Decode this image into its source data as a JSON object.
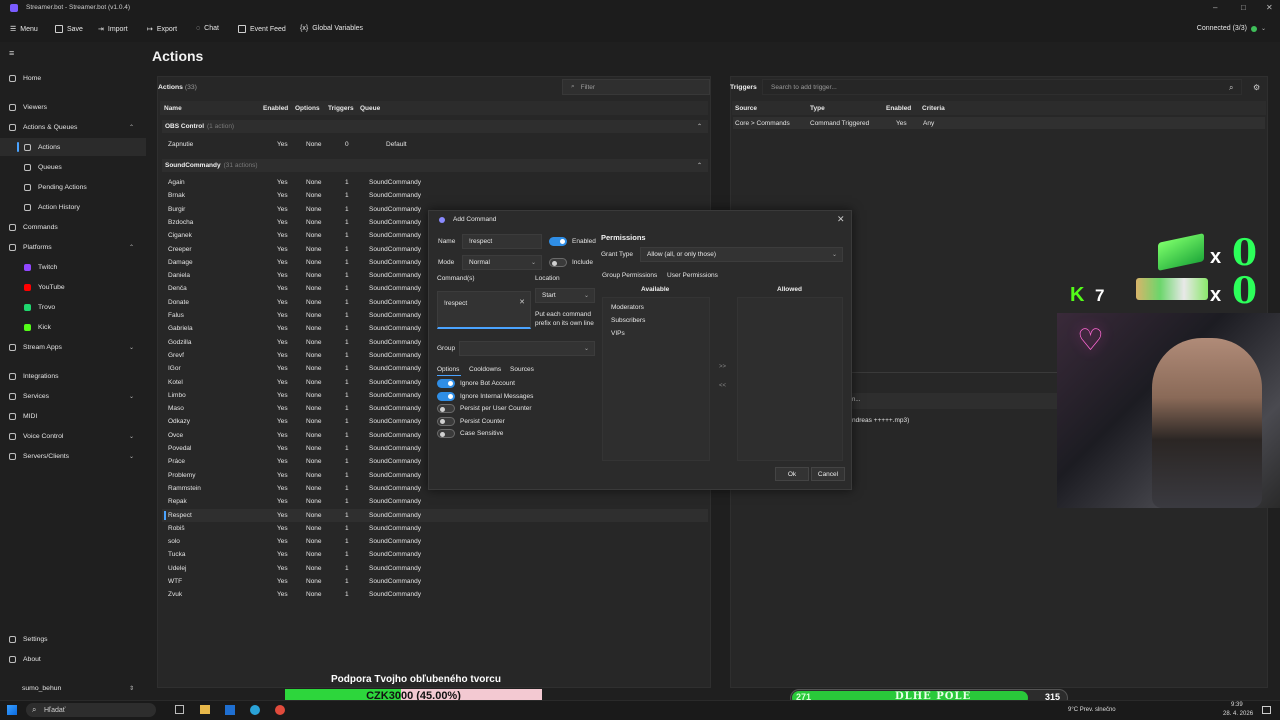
{
  "window": {
    "title": "Streamer.bot - Streamer.bot (v1.0.4)"
  },
  "toolbar": {
    "items": [
      "Menu",
      "Save",
      "Import",
      "Export",
      "Chat",
      "Event Feed",
      "Global Variables"
    ],
    "connection": "Connected (3/3)"
  },
  "sidebar": {
    "items": [
      "Home",
      "Viewers",
      "Actions & Queues",
      "Actions",
      "Queues",
      "Pending Actions",
      "Action History",
      "Commands",
      "Platforms",
      "Twitch",
      "YouTube",
      "Trovo",
      "Kick",
      "Stream Apps",
      "Integrations",
      "Services",
      "MIDI",
      "Voice Control",
      "Servers/Clients",
      "Settings",
      "About"
    ],
    "user": "sumo_behun"
  },
  "page": {
    "title": "Actions"
  },
  "actions": {
    "header": "Actions",
    "count": "(33)",
    "filter_placeholder": "Filter",
    "columns": [
      "Name",
      "Enabled",
      "Options",
      "Triggers",
      "Queue"
    ],
    "groups": [
      {
        "name": "OBS Control",
        "count": "(1 action)"
      },
      {
        "name": "SoundCommandy",
        "count": "(31 actions)"
      }
    ],
    "obs_row": {
      "name": "Zapnutie",
      "enabled": "Yes",
      "options": "None",
      "triggers": "0",
      "queue": "Default"
    },
    "sound_rows": [
      "Again",
      "Brnak",
      "Burgir",
      "Bzdocha",
      "Ciganek",
      "Creeper",
      "Damage",
      "Daniela",
      "Denča",
      "Donate",
      "Falus",
      "Gabriela",
      "Godzilla",
      "Grevf",
      "IGor",
      "Kotel",
      "Limbo",
      "Maso",
      "Odkazy",
      "Ovce",
      "Povedal",
      "Práce",
      "Problemy",
      "Rammstein",
      "Repak",
      "Respect",
      "Robiš",
      "solo",
      "Tucka",
      "Udelej",
      "WTF",
      "Zvuk"
    ],
    "sound_enabled": "Yes",
    "sound_options": "None",
    "sound_triggers": "1",
    "sound_queue": "SoundCommandy",
    "selected": "Respect"
  },
  "triggers": {
    "header": "Triggers",
    "search_placeholder": "Search to add trigger...",
    "columns": [
      "Source",
      "Type",
      "Enabled",
      "Criteria"
    ],
    "row": {
      "source": "Core > Commands",
      "type": "Command Triggered",
      "enabled": "Yes",
      "criteria": "Any"
    },
    "subpanel_snippet": "n...",
    "subpanel_file": "ndreas +++++.mp3)"
  },
  "dialog": {
    "title": "Add Command",
    "name_label": "Name",
    "name_value": "!respect",
    "enabled_label": "Enabled",
    "mode_label": "Mode",
    "mode_value": "Normal",
    "include_label": "Include",
    "commands_label": "Command(s)",
    "commands_value": "!respect",
    "location_label": "Location",
    "location_value": "Start",
    "location_hint": "Put each command prefix on its own line",
    "group_label": "Group",
    "tabs": [
      "Options",
      "Cooldowns",
      "Sources"
    ],
    "options": [
      {
        "label": "Ignore Bot Account",
        "on": true
      },
      {
        "label": "Ignore Internal Messages",
        "on": true
      },
      {
        "label": "Persist per User Counter",
        "on": false
      },
      {
        "label": "Persist Counter",
        "on": false
      },
      {
        "label": "Case Sensitive",
        "on": false
      }
    ],
    "permissions_title": "Permissions",
    "grant_label": "Grant Type",
    "grant_value": "Allow (all, or only those)",
    "perm_tabs": [
      "Group Permissions",
      "User Permissions"
    ],
    "available_label": "Available",
    "allowed_label": "Allowed",
    "available_items": [
      "Moderators",
      "Subscribers",
      "VIPs"
    ],
    "move_right": ">>",
    "move_left": "<<",
    "ok": "Ok",
    "cancel": "Cancel"
  },
  "overlay": {
    "kick_count": "7",
    "x0_top": "0",
    "x0_bottom": "0",
    "support_text": "Podpora Tvojho obľubeného tvorcu",
    "donate_text": "CZK3000 (45.00%)",
    "donate_progress": 0.45,
    "pole_left": "271",
    "pole_label": "DLHE POLE",
    "pole_right": "315",
    "pole_progress": 0.86
  },
  "taskbar": {
    "search": "Hľadať",
    "weather": "9°C  Prev. slnečno",
    "time": "9:39",
    "date": "28. 4. 2026"
  }
}
